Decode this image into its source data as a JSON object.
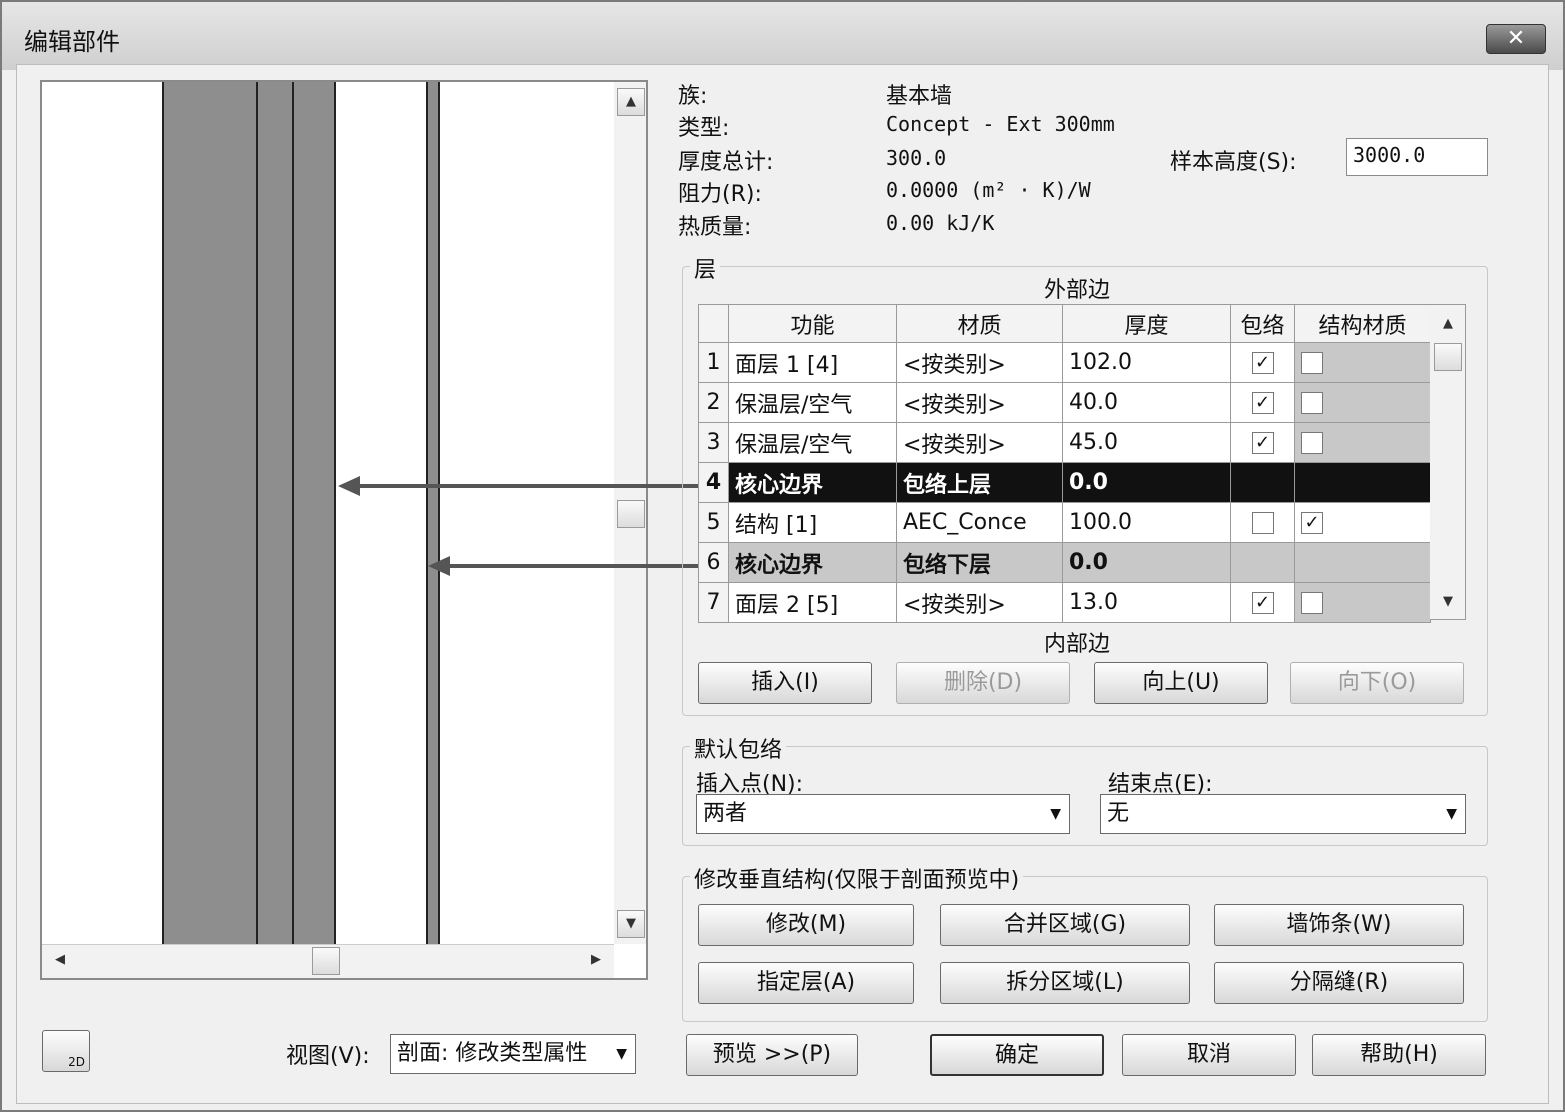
{
  "window": {
    "title": "编辑部件",
    "close_label": "✕"
  },
  "info": {
    "family_label": "族:",
    "family_value": "基本墙",
    "type_label": "类型:",
    "type_value": "Concept - Ext 300mm",
    "thickness_label": "厚度总计:",
    "thickness_value": "300.0",
    "resistance_label": "阻力(R):",
    "resistance_value": "0.0000 (m² · K)/W",
    "thermal_label": "热质量:",
    "thermal_value": "0.00 kJ/K",
    "sample_height_label": "样本高度(S):",
    "sample_height_value": "3000.0"
  },
  "layers": {
    "group_title": "层",
    "exterior_label": "外部边",
    "interior_label": "内部边",
    "columns": [
      "",
      "功能",
      "材质",
      "厚度",
      "包络",
      "结构材质"
    ],
    "rows": [
      {
        "num": "1",
        "function": "面层 1 [4]",
        "material": "<按类别>",
        "thickness": "102.0",
        "wrap": true,
        "structural": false
      },
      {
        "num": "2",
        "function": "保温层/空气",
        "material": "<按类别>",
        "thickness": "40.0",
        "wrap": true,
        "structural": false
      },
      {
        "num": "3",
        "function": "保温层/空气",
        "material": "<按类别>",
        "thickness": "45.0",
        "wrap": true,
        "structural": false
      },
      {
        "num": "4",
        "function": "核心边界",
        "material": "包络上层",
        "thickness": "0.0",
        "wrap": null,
        "structural": null
      },
      {
        "num": "5",
        "function": "结构 [1]",
        "material": "AEC_Conce",
        "thickness": "100.0",
        "wrap": false,
        "structural": true
      },
      {
        "num": "6",
        "function": "核心边界",
        "material": "包络下层",
        "thickness": "0.0",
        "wrap": null,
        "structural": null
      },
      {
        "num": "7",
        "function": "面层 2 [5]",
        "material": "<按类别>",
        "thickness": "13.0",
        "wrap": true,
        "structural": false
      }
    ],
    "selected_row": "4",
    "buttons": {
      "insert": "插入(I)",
      "delete": "删除(D)",
      "up": "向上(U)",
      "down": "向下(O)"
    }
  },
  "wrapping": {
    "group_title": "默认包络",
    "insert_label": "插入点(N):",
    "insert_value": "两者",
    "end_label": "结束点(E):",
    "end_value": "无"
  },
  "vertical": {
    "group_title": "修改垂直结构(仅限于剖面预览中)",
    "modify": "修改(M)",
    "merge": "合并区域(G)",
    "sweeps": "墙饰条(W)",
    "assign": "指定层(A)",
    "split": "拆分区域(L)",
    "reveals": "分隔缝(R)"
  },
  "footer": {
    "view_label": "视图(V):",
    "view_value": "剖面: 修改类型属性",
    "preview": "预览 >>(P)",
    "ok": "确定",
    "cancel": "取消",
    "help": "帮助(H)",
    "icon_text": "2D"
  },
  "preview_bands": {
    "exterior_finish_fraction": 0.34,
    "colors": {
      "band": "#8e8e8e",
      "background": "#ffffff"
    }
  }
}
